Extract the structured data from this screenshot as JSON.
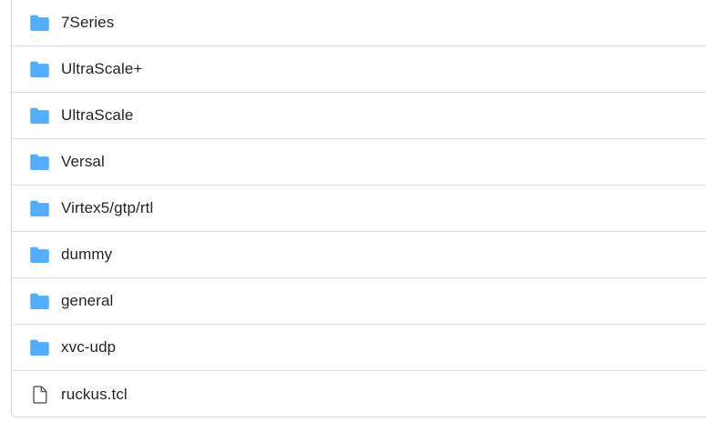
{
  "colors": {
    "folder_icon": "#54aeff",
    "file_icon": "#59636e",
    "text": "#1f2328",
    "border": "#d0d7de"
  },
  "entries": [
    {
      "name": "7Series",
      "type": "folder",
      "icon": "folder-icon"
    },
    {
      "name": "UltraScale+",
      "type": "folder",
      "icon": "folder-icon"
    },
    {
      "name": "UltraScale",
      "type": "folder",
      "icon": "folder-icon"
    },
    {
      "name": "Versal",
      "type": "folder",
      "icon": "folder-icon"
    },
    {
      "name": "Virtex5/gtp/rtl",
      "type": "folder",
      "icon": "folder-icon"
    },
    {
      "name": "dummy",
      "type": "folder",
      "icon": "folder-icon"
    },
    {
      "name": "general",
      "type": "folder",
      "icon": "folder-icon"
    },
    {
      "name": "xvc-udp",
      "type": "folder",
      "icon": "folder-icon"
    },
    {
      "name": "ruckus.tcl",
      "type": "file",
      "icon": "file-icon"
    }
  ]
}
